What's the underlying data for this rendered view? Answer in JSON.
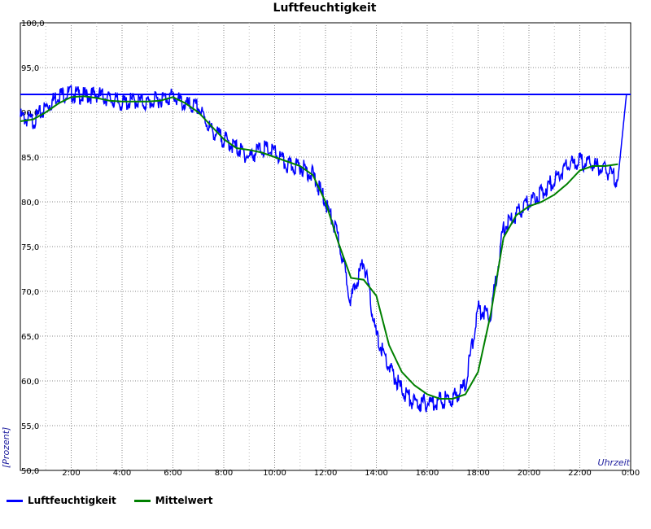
{
  "chart_data": {
    "type": "line",
    "title": "Luftfeuchtigkeit",
    "xlabel": "Uhrzeit",
    "ylabel": "[Prozent]",
    "ylim": [
      50,
      100
    ],
    "xlim": [
      0,
      24
    ],
    "yticks": [
      "50,0",
      "55,0",
      "60,0",
      "65,0",
      "70,0",
      "75,0",
      "80,0",
      "85,0",
      "90,0",
      "95,0",
      "100,0"
    ],
    "xticks": [
      "2:00",
      "4:00",
      "6:00",
      "8:00",
      "10:00",
      "12:00",
      "14:00",
      "16:00",
      "18:00",
      "20:00",
      "22:00",
      "0:00"
    ],
    "grid": true,
    "legend_position": "bottom-left",
    "reference_line": {
      "y": 92.0,
      "color": "#0000ff"
    },
    "series": [
      {
        "name": "Luftfeuchtigkeit",
        "color": "#0000ff",
        "x": [
          "0:00",
          "0:30",
          "1:00",
          "1:30",
          "2:00",
          "2:30",
          "3:00",
          "3:30",
          "4:00",
          "4:30",
          "5:00",
          "5:30",
          "6:00",
          "6:30",
          "7:00",
          "7:30",
          "8:00",
          "8:30",
          "9:00",
          "9:30",
          "10:00",
          "10:30",
          "11:00",
          "11:30",
          "12:00",
          "12:30",
          "13:00",
          "13:30",
          "14:00",
          "14:30",
          "15:00",
          "15:30",
          "16:00",
          "16:30",
          "17:00",
          "17:30",
          "18:00",
          "18:30",
          "19:00",
          "19:30",
          "20:00",
          "20:30",
          "21:00",
          "21:30",
          "22:00",
          "22:30",
          "23:00",
          "23:30",
          "23:50"
        ],
        "values": [
          89.5,
          89.0,
          90.5,
          92.0,
          92.1,
          91.8,
          92.0,
          91.5,
          91.0,
          91.3,
          91.0,
          91.5,
          91.8,
          90.8,
          90.5,
          88.0,
          87.0,
          86.0,
          85.0,
          86.0,
          85.5,
          84.0,
          84.0,
          83.0,
          80.0,
          76.0,
          69.0,
          73.5,
          65.0,
          61.5,
          59.0,
          57.5,
          57.5,
          57.8,
          58.0,
          59.5,
          68.0,
          67.5,
          77.0,
          78.5,
          80.0,
          81.0,
          82.5,
          84.0,
          84.5,
          84.2,
          83.5,
          82.5,
          92.0
        ]
      },
      {
        "name": "Mittelwert",
        "color": "#008000",
        "x": [
          "0:00",
          "0:30",
          "1:00",
          "1:30",
          "2:00",
          "2:30",
          "3:00",
          "3:30",
          "4:00",
          "4:30",
          "5:00",
          "5:30",
          "6:00",
          "6:30",
          "7:00",
          "7:30",
          "8:00",
          "8:30",
          "9:00",
          "9:30",
          "10:00",
          "10:30",
          "11:00",
          "11:30",
          "12:00",
          "12:30",
          "13:00",
          "13:30",
          "14:00",
          "14:30",
          "15:00",
          "15:30",
          "16:00",
          "16:30",
          "17:00",
          "17:30",
          "18:00",
          "18:30",
          "19:00",
          "19:30",
          "20:00",
          "20:30",
          "21:00",
          "21:30",
          "22:00",
          "22:30",
          "23:00",
          "23:30"
        ],
        "values": [
          89.0,
          89.2,
          90.0,
          91.0,
          91.7,
          91.8,
          91.6,
          91.3,
          91.2,
          91.2,
          91.2,
          91.3,
          91.7,
          91.0,
          90.0,
          88.5,
          87.0,
          86.0,
          85.8,
          85.5,
          85.0,
          84.5,
          84.0,
          83.0,
          80.0,
          75.5,
          71.5,
          71.3,
          69.5,
          64.0,
          61.0,
          59.5,
          58.5,
          58.0,
          58.0,
          58.5,
          61.0,
          67.5,
          76.0,
          78.5,
          79.5,
          80.0,
          80.8,
          82.0,
          83.5,
          84.0,
          84.0,
          84.2
        ]
      }
    ]
  }
}
